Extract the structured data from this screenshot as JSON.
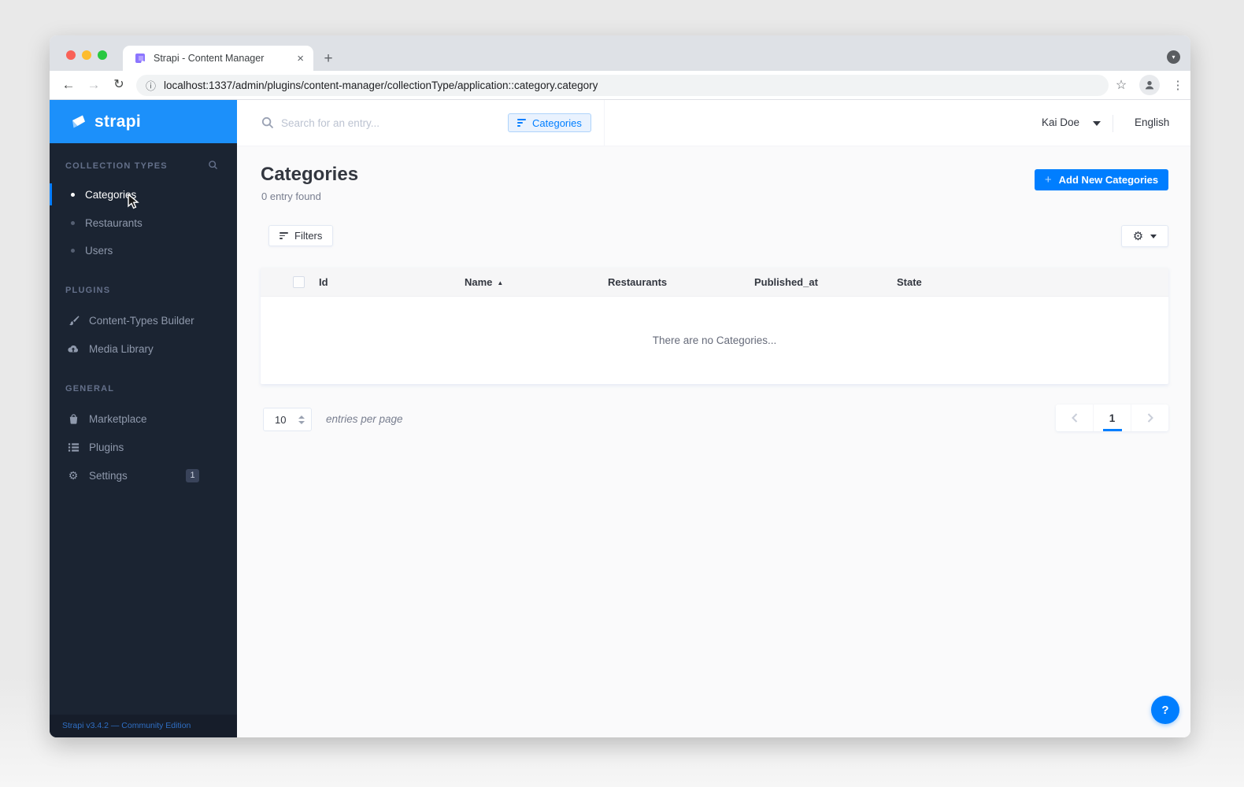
{
  "icons": {
    "back": "←",
    "forward": "→",
    "reload": "↻",
    "info": "ⓘ",
    "star": "☆",
    "dots": "⋮",
    "plus": "+",
    "close": "×",
    "caret_down": "▾",
    "sort_asc": "▲",
    "gear": "⚙",
    "help": "?"
  },
  "browser": {
    "tab_title": "Strapi - Content Manager",
    "url": "localhost:1337/admin/plugins/content-manager/collectionType/application::category.category"
  },
  "topbar": {
    "search_placeholder": "Search for an entry...",
    "chip_label": "Categories",
    "user_name": "Kai Doe",
    "language": "English"
  },
  "sidebar": {
    "logo_text": "strapi",
    "sections": [
      {
        "heading": "COLLECTION TYPES",
        "items": [
          {
            "label": "Categories"
          },
          {
            "label": "Restaurants"
          },
          {
            "label": "Users"
          }
        ]
      },
      {
        "heading": "PLUGINS",
        "items": [
          {
            "label": "Content-Types Builder"
          },
          {
            "label": "Media Library"
          }
        ]
      },
      {
        "heading": "GENERAL",
        "items": [
          {
            "label": "Marketplace"
          },
          {
            "label": "Plugins"
          },
          {
            "label": "Settings",
            "badge": "1"
          }
        ]
      }
    ],
    "footer": "Strapi v3.4.2 — Community Edition"
  },
  "main": {
    "title": "Categories",
    "subtitle": "0 entry found",
    "add_button_label": "Add New Categories",
    "filters_button_label": "Filters",
    "table": {
      "columns": [
        "Id",
        "Name",
        "Restaurants",
        "Published_at",
        "State"
      ],
      "sorted_column": "Name",
      "sort_direction": "asc",
      "empty_message": "There are no Categories...",
      "rows": []
    },
    "pagination": {
      "entries_per_page": "10",
      "entries_label": "entries per page",
      "current_page": "1"
    }
  },
  "colors": {
    "primary": "#007eff",
    "logo_bg": "#1c90fa",
    "sidebar_bg": "#1b2432"
  }
}
